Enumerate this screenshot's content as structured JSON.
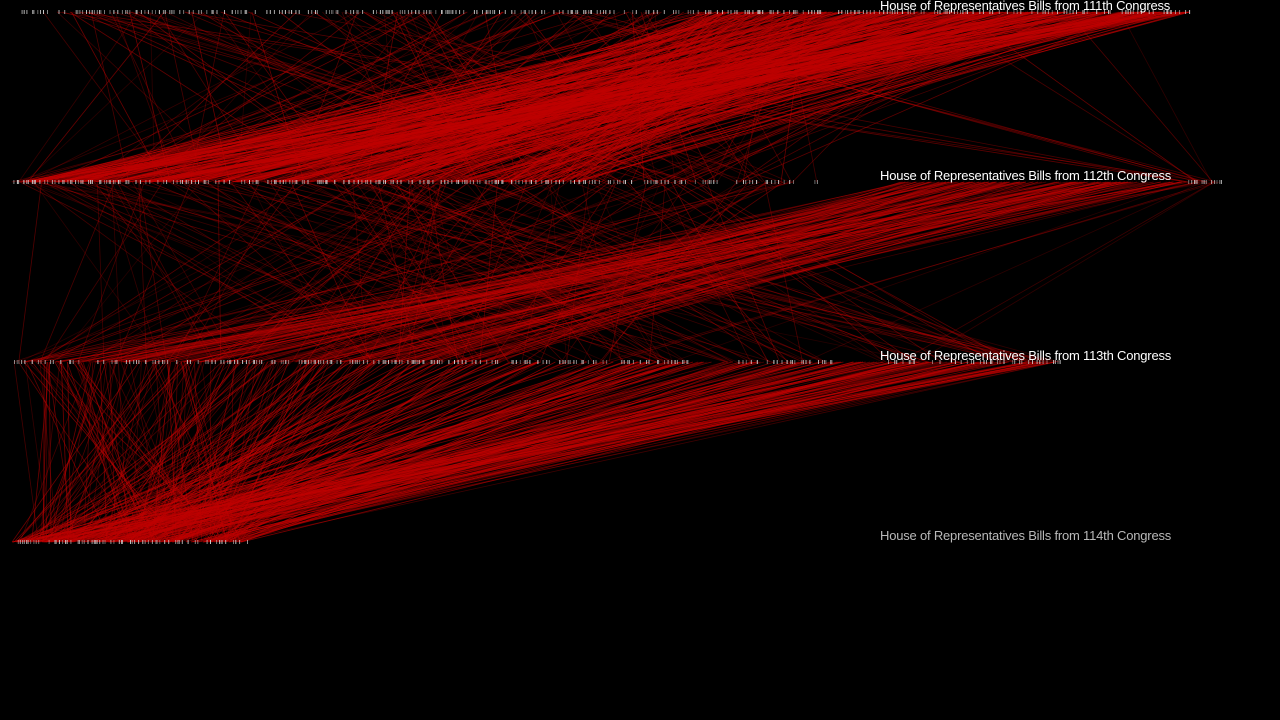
{
  "rows": [
    {
      "label": "House of Representatives Bills from 111th Congress"
    },
    {
      "label": "House of Representatives Bills from 112th Congress"
    },
    {
      "label": "House of Representatives Bills from 113th Congress"
    },
    {
      "label": "House of Representatives Bills from 114th Congress"
    }
  ],
  "colors": {
    "background": "#000000",
    "link": "#c00000",
    "tick": "#cfcfcf",
    "label": "#ffffff",
    "label_dim": "#b8b8b8"
  }
}
